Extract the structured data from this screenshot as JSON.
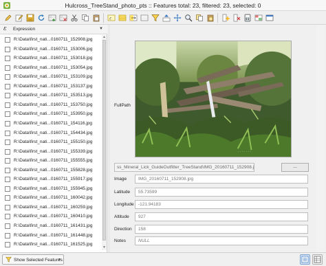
{
  "window": {
    "title": "Hulcross_TreeStand_photo_pts :: Features total: 23, filtered: 23, selected: 0"
  },
  "toolbar": {
    "buttons": [
      "pencil-icon",
      "pencil-edit-icon",
      "save-icon",
      "reload-icon",
      "add-feature-icon",
      "delete-icon",
      "cut-icon",
      "copy-icon",
      "paste-icon",
      "expression-select-icon",
      "select-all-icon",
      "invert-selection-icon",
      "deselect-icon",
      "filter-icon",
      "move-top-icon",
      "pan-icon",
      "zoom-icon",
      "copy-features-icon",
      "paste-features-icon",
      "new-field-icon",
      "delete-field-icon",
      "field-calculator-icon",
      "conditional-format-icon",
      "dock-icon"
    ]
  },
  "expression_bar": {
    "label": "Expression"
  },
  "features": [
    "R:\\Data\\first_nati...0160711_152908.jpg",
    "R:\\Data\\first_nati...0160711_153006.jpg",
    "R:\\Data\\first_nati...0160711_153018.jpg",
    "R:\\Data\\first_nati...0160711_153054.jpg",
    "R:\\Data\\first_nati...0160711_153109.jpg",
    "R:\\Data\\first_nati...0160711_153137.jpg",
    "R:\\Data\\first_nati...0160711_153513.jpg",
    "R:\\Data\\first_nati...0160711_153750.jpg",
    "R:\\Data\\first_nati...0160711_153950.jpg",
    "R:\\Data\\first_nati...0160711_154116.jpg",
    "R:\\Data\\first_nati...0160711_154434.jpg",
    "R:\\Data\\first_nati...0160711_155150.jpg",
    "R:\\Data\\first_nati...0160711_155339.jpg",
    "R:\\Data\\first_nati...0160711_155555.jpg",
    "R:\\Data\\first_nati...0160711_155828.jpg",
    "R:\\Data\\first_nati...0160711_155917.jpg",
    "R:\\Data\\first_nati...0160711_155945.jpg",
    "R:\\Data\\first_nati...0160711_160042.jpg",
    "R:\\Data\\first_nati...0160711_160259.jpg",
    "R:\\Data\\first_nati...0160711_160410.jpg",
    "R:\\Data\\first_nati...0160711_161431.jpg",
    "R:\\Data\\first_nati...0160711_161448.jpg",
    "R:\\Data\\first_nati...0160711_161525.jpg"
  ],
  "form": {
    "fullpath_label": "FullPath",
    "fullpath_value": "ss_Mineral_Lick_GuideOutfitter_TreeStand\\IMG_20160711_152908.jpg",
    "browse_label": "...",
    "fields": [
      {
        "label": "Image",
        "value": "IMG_20160711_152908.jpg"
      },
      {
        "label": "Latitude",
        "value": "55.73599"
      },
      {
        "label": "Longitude",
        "value": "-121.94183"
      },
      {
        "label": "Altitude",
        "value": "927"
      },
      {
        "label": "Direction",
        "value": "158"
      },
      {
        "label": "Notes",
        "value": "NULL"
      }
    ]
  },
  "bottom_bar": {
    "show_label": "Show Selected Features"
  },
  "colors": {
    "photo_foliage": "#3f5a2c",
    "photo_light": "#9fb46c",
    "log": "#7a6a58",
    "active_view": "#d8e6f5"
  }
}
